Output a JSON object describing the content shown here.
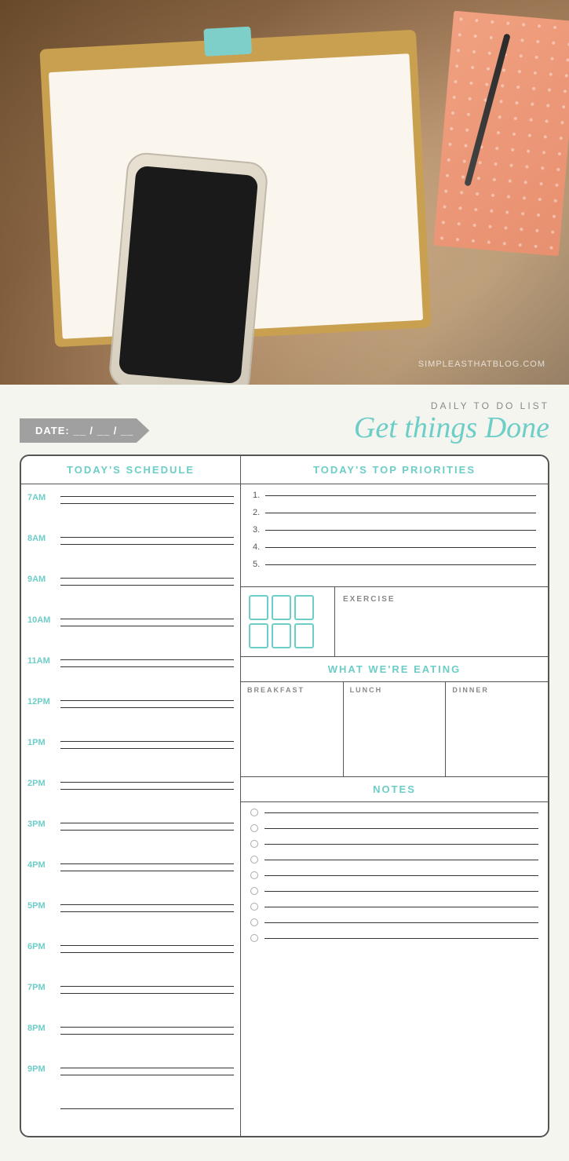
{
  "photo": {
    "watermark": "SIMPLEASTHATBLOG.COM"
  },
  "header": {
    "date_label": "DATE:  __ / __ / __",
    "daily_label": "DAILY TO DO LIST",
    "title": "Get things Done"
  },
  "schedule": {
    "title": "TODAY'S SCHEDULE",
    "times": [
      "7AM",
      "8AM",
      "9AM",
      "10AM",
      "11AM",
      "12PM",
      "1PM",
      "2PM",
      "3PM",
      "4PM",
      "5PM",
      "6PM",
      "7PM",
      "8PM",
      "9PM"
    ]
  },
  "priorities": {
    "title": "TODAY'S TOP PRIORITIES",
    "items": [
      "1.",
      "2.",
      "3.",
      "4.",
      "5."
    ]
  },
  "exercise": {
    "label": "EXERCISE"
  },
  "eating": {
    "title": "WHAT WE'RE EATING",
    "breakfast": "BREAKFAST",
    "lunch": "LUNCH",
    "dinner": "DINNER"
  },
  "notes": {
    "title": "NOTES",
    "count": 9
  }
}
